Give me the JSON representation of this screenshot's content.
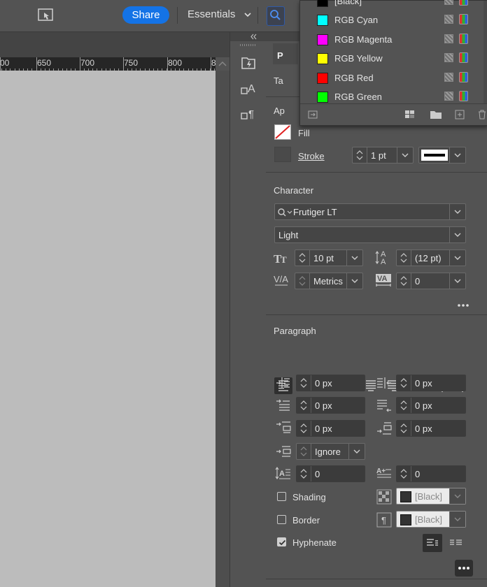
{
  "topbar": {
    "share_label": "Share",
    "workspace_label": "Essentials"
  },
  "ruler": {
    "labels": [
      "00",
      "650",
      "700",
      "750",
      "800",
      "8"
    ]
  },
  "panel": {
    "tab_letter": "P",
    "tab2_letter": "Ta",
    "appearance_letter": "Ap",
    "fill_label": "Fill",
    "stroke_label": "Stroke",
    "stroke_weight": "1 pt"
  },
  "character": {
    "title": "Character",
    "font_family": "Frutiger LT",
    "font_style": "Light",
    "font_size": "10 pt",
    "leading": "(12 pt)",
    "kerning": "Metrics",
    "tracking": "0"
  },
  "paragraph": {
    "title": "Paragraph",
    "left_indent": "0 px",
    "right_indent": "0 px",
    "first_line_indent": "0 px",
    "last_line_indent": "0 px",
    "space_before": "0 px",
    "space_after": "0 px",
    "align_to_grid": "Ignore",
    "drop_cap_lines": "0",
    "drop_cap_chars": "0",
    "shading_label": "Shading",
    "shading_color": "[Black]",
    "border_label": "Border",
    "border_color": "[Black]",
    "hyphenate_label": "Hyphenate",
    "hyphenate_checked": true
  },
  "swatches": {
    "items": [
      {
        "name": "[Black]",
        "color": "#000000"
      },
      {
        "name": "RGB Cyan",
        "color": "#00ffff"
      },
      {
        "name": "RGB Magenta",
        "color": "#ff00ff"
      },
      {
        "name": "RGB Yellow",
        "color": "#ffff00"
      },
      {
        "name": "RGB Red",
        "color": "#ff0000"
      },
      {
        "name": "RGB Green",
        "color": "#00ff00"
      }
    ]
  },
  "colors": {
    "accent": "#1473e6",
    "panel_bg": "#535353",
    "pasteboard": "#bcbcbc"
  }
}
